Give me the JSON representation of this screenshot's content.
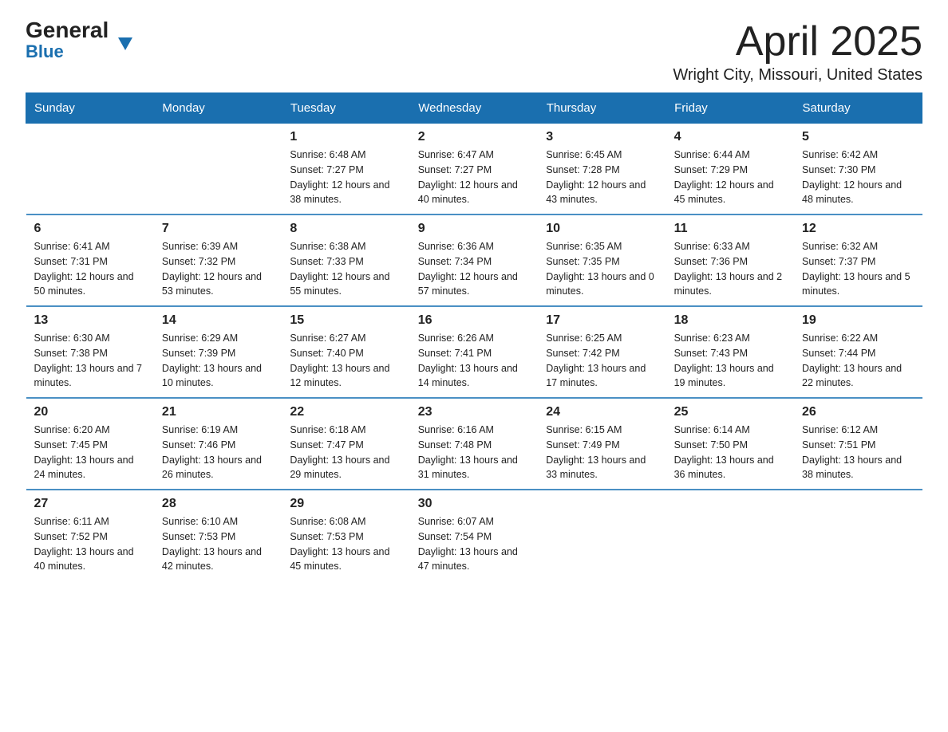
{
  "logo": {
    "text_general": "General",
    "triangle_symbol": "▼",
    "text_blue": "Blue"
  },
  "title": "April 2025",
  "subtitle": "Wright City, Missouri, United States",
  "days_of_week": [
    "Sunday",
    "Monday",
    "Tuesday",
    "Wednesday",
    "Thursday",
    "Friday",
    "Saturday"
  ],
  "weeks": [
    [
      {
        "day": "",
        "sunrise": "",
        "sunset": "",
        "daylight": ""
      },
      {
        "day": "",
        "sunrise": "",
        "sunset": "",
        "daylight": ""
      },
      {
        "day": "1",
        "sunrise": "Sunrise: 6:48 AM",
        "sunset": "Sunset: 7:27 PM",
        "daylight": "Daylight: 12 hours and 38 minutes."
      },
      {
        "day": "2",
        "sunrise": "Sunrise: 6:47 AM",
        "sunset": "Sunset: 7:27 PM",
        "daylight": "Daylight: 12 hours and 40 minutes."
      },
      {
        "day": "3",
        "sunrise": "Sunrise: 6:45 AM",
        "sunset": "Sunset: 7:28 PM",
        "daylight": "Daylight: 12 hours and 43 minutes."
      },
      {
        "day": "4",
        "sunrise": "Sunrise: 6:44 AM",
        "sunset": "Sunset: 7:29 PM",
        "daylight": "Daylight: 12 hours and 45 minutes."
      },
      {
        "day": "5",
        "sunrise": "Sunrise: 6:42 AM",
        "sunset": "Sunset: 7:30 PM",
        "daylight": "Daylight: 12 hours and 48 minutes."
      }
    ],
    [
      {
        "day": "6",
        "sunrise": "Sunrise: 6:41 AM",
        "sunset": "Sunset: 7:31 PM",
        "daylight": "Daylight: 12 hours and 50 minutes."
      },
      {
        "day": "7",
        "sunrise": "Sunrise: 6:39 AM",
        "sunset": "Sunset: 7:32 PM",
        "daylight": "Daylight: 12 hours and 53 minutes."
      },
      {
        "day": "8",
        "sunrise": "Sunrise: 6:38 AM",
        "sunset": "Sunset: 7:33 PM",
        "daylight": "Daylight: 12 hours and 55 minutes."
      },
      {
        "day": "9",
        "sunrise": "Sunrise: 6:36 AM",
        "sunset": "Sunset: 7:34 PM",
        "daylight": "Daylight: 12 hours and 57 minutes."
      },
      {
        "day": "10",
        "sunrise": "Sunrise: 6:35 AM",
        "sunset": "Sunset: 7:35 PM",
        "daylight": "Daylight: 13 hours and 0 minutes."
      },
      {
        "day": "11",
        "sunrise": "Sunrise: 6:33 AM",
        "sunset": "Sunset: 7:36 PM",
        "daylight": "Daylight: 13 hours and 2 minutes."
      },
      {
        "day": "12",
        "sunrise": "Sunrise: 6:32 AM",
        "sunset": "Sunset: 7:37 PM",
        "daylight": "Daylight: 13 hours and 5 minutes."
      }
    ],
    [
      {
        "day": "13",
        "sunrise": "Sunrise: 6:30 AM",
        "sunset": "Sunset: 7:38 PM",
        "daylight": "Daylight: 13 hours and 7 minutes."
      },
      {
        "day": "14",
        "sunrise": "Sunrise: 6:29 AM",
        "sunset": "Sunset: 7:39 PM",
        "daylight": "Daylight: 13 hours and 10 minutes."
      },
      {
        "day": "15",
        "sunrise": "Sunrise: 6:27 AM",
        "sunset": "Sunset: 7:40 PM",
        "daylight": "Daylight: 13 hours and 12 minutes."
      },
      {
        "day": "16",
        "sunrise": "Sunrise: 6:26 AM",
        "sunset": "Sunset: 7:41 PM",
        "daylight": "Daylight: 13 hours and 14 minutes."
      },
      {
        "day": "17",
        "sunrise": "Sunrise: 6:25 AM",
        "sunset": "Sunset: 7:42 PM",
        "daylight": "Daylight: 13 hours and 17 minutes."
      },
      {
        "day": "18",
        "sunrise": "Sunrise: 6:23 AM",
        "sunset": "Sunset: 7:43 PM",
        "daylight": "Daylight: 13 hours and 19 minutes."
      },
      {
        "day": "19",
        "sunrise": "Sunrise: 6:22 AM",
        "sunset": "Sunset: 7:44 PM",
        "daylight": "Daylight: 13 hours and 22 minutes."
      }
    ],
    [
      {
        "day": "20",
        "sunrise": "Sunrise: 6:20 AM",
        "sunset": "Sunset: 7:45 PM",
        "daylight": "Daylight: 13 hours and 24 minutes."
      },
      {
        "day": "21",
        "sunrise": "Sunrise: 6:19 AM",
        "sunset": "Sunset: 7:46 PM",
        "daylight": "Daylight: 13 hours and 26 minutes."
      },
      {
        "day": "22",
        "sunrise": "Sunrise: 6:18 AM",
        "sunset": "Sunset: 7:47 PM",
        "daylight": "Daylight: 13 hours and 29 minutes."
      },
      {
        "day": "23",
        "sunrise": "Sunrise: 6:16 AM",
        "sunset": "Sunset: 7:48 PM",
        "daylight": "Daylight: 13 hours and 31 minutes."
      },
      {
        "day": "24",
        "sunrise": "Sunrise: 6:15 AM",
        "sunset": "Sunset: 7:49 PM",
        "daylight": "Daylight: 13 hours and 33 minutes."
      },
      {
        "day": "25",
        "sunrise": "Sunrise: 6:14 AM",
        "sunset": "Sunset: 7:50 PM",
        "daylight": "Daylight: 13 hours and 36 minutes."
      },
      {
        "day": "26",
        "sunrise": "Sunrise: 6:12 AM",
        "sunset": "Sunset: 7:51 PM",
        "daylight": "Daylight: 13 hours and 38 minutes."
      }
    ],
    [
      {
        "day": "27",
        "sunrise": "Sunrise: 6:11 AM",
        "sunset": "Sunset: 7:52 PM",
        "daylight": "Daylight: 13 hours and 40 minutes."
      },
      {
        "day": "28",
        "sunrise": "Sunrise: 6:10 AM",
        "sunset": "Sunset: 7:53 PM",
        "daylight": "Daylight: 13 hours and 42 minutes."
      },
      {
        "day": "29",
        "sunrise": "Sunrise: 6:08 AM",
        "sunset": "Sunset: 7:53 PM",
        "daylight": "Daylight: 13 hours and 45 minutes."
      },
      {
        "day": "30",
        "sunrise": "Sunrise: 6:07 AM",
        "sunset": "Sunset: 7:54 PM",
        "daylight": "Daylight: 13 hours and 47 minutes."
      },
      {
        "day": "",
        "sunrise": "",
        "sunset": "",
        "daylight": ""
      },
      {
        "day": "",
        "sunrise": "",
        "sunset": "",
        "daylight": ""
      },
      {
        "day": "",
        "sunrise": "",
        "sunset": "",
        "daylight": ""
      }
    ]
  ]
}
